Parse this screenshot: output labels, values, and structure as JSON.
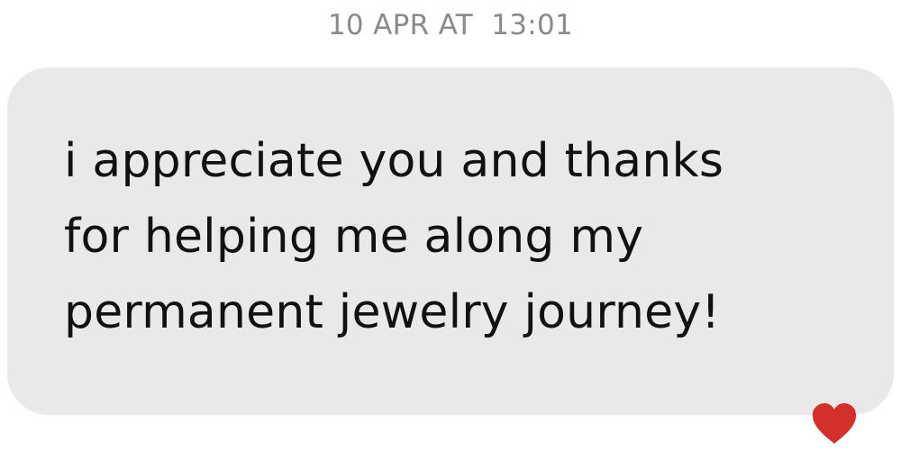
{
  "timestamp": "10 APR AT  13:01",
  "message": {
    "lines": [
      "i appreciate you and thanks",
      "for helping me along my",
      "permanent jewelry journey!"
    ]
  },
  "reaction": {
    "icon": "heart-icon",
    "color": "#d3302c"
  },
  "colors": {
    "bubble": "#e9e9e9",
    "timestamp": "#8a8a8a",
    "text": "#111111"
  }
}
